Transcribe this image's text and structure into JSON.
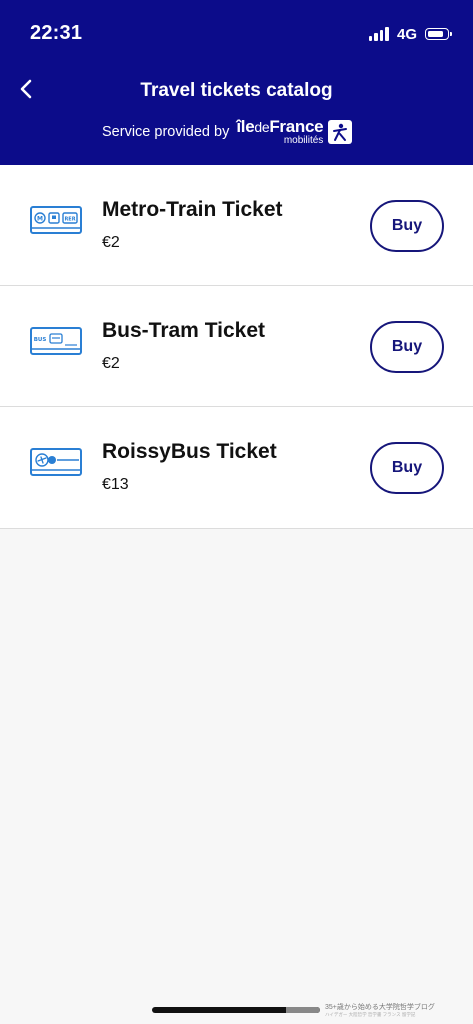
{
  "status_bar": {
    "time": "22:31",
    "network": "4G"
  },
  "header": {
    "title": "Travel tickets catalog",
    "provided_by": "Service provided by",
    "brand": {
      "name_part1": "île",
      "name_part2": "de",
      "name_part3": "France",
      "subtitle": "mobilités"
    }
  },
  "tickets": [
    {
      "name": "Metro-Train Ticket",
      "price": "€2",
      "buy_label": "Buy",
      "icon": "metro-train-ticket-icon"
    },
    {
      "name": "Bus-Tram Ticket",
      "price": "€2",
      "buy_label": "Buy",
      "icon": "bus-tram-ticket-icon"
    },
    {
      "name": "RoissyBus Ticket",
      "price": "€13",
      "buy_label": "Buy",
      "icon": "roissybus-ticket-icon"
    }
  ],
  "watermark": {
    "line1": "35+歳から始める大学院哲学ブログ",
    "line2": "ハイデガー 大陸哲学 哲学書 フランス 留学記"
  },
  "colors": {
    "header_bg": "#0c0c8a",
    "accent": "#16167a",
    "icon_blue": "#2a7fd4",
    "page_bg": "#f7f7f7"
  }
}
